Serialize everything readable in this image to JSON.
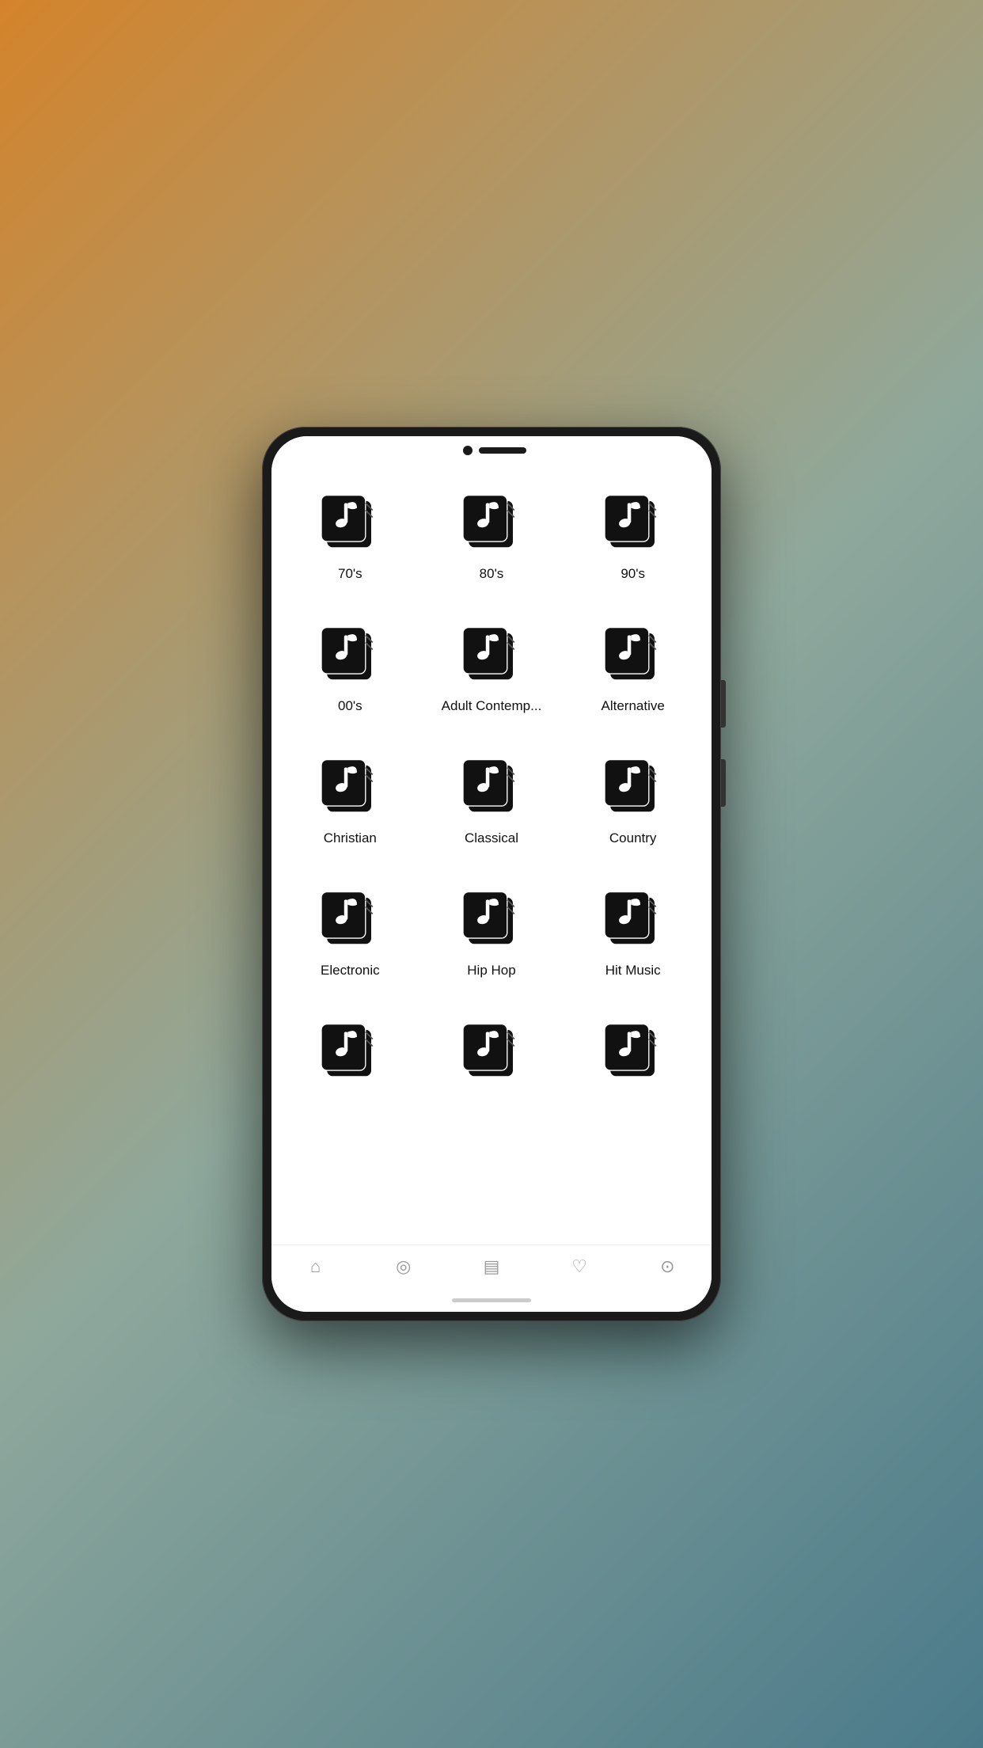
{
  "background": {
    "gradient_start": "#d4832a",
    "gradient_end": "#4a7a8a"
  },
  "genres": [
    {
      "id": "70s",
      "label": "70's"
    },
    {
      "id": "80s",
      "label": "80's"
    },
    {
      "id": "90s",
      "label": "90's"
    },
    {
      "id": "00s",
      "label": "00's"
    },
    {
      "id": "adult-contemp",
      "label": "Adult Contemp..."
    },
    {
      "id": "alternative",
      "label": "Alternative"
    },
    {
      "id": "christian",
      "label": "Christian"
    },
    {
      "id": "classical",
      "label": "Classical"
    },
    {
      "id": "country",
      "label": "Country"
    },
    {
      "id": "electronic",
      "label": "Electronic"
    },
    {
      "id": "hip-hop",
      "label": "Hip Hop"
    },
    {
      "id": "hit-music",
      "label": "Hit Music"
    },
    {
      "id": "partial1",
      "label": ""
    },
    {
      "id": "partial2",
      "label": ""
    },
    {
      "id": "partial3",
      "label": ""
    }
  ],
  "nav": {
    "home": "⌂",
    "search": "◎",
    "browse": "▤",
    "heart": "♡",
    "profile": "⊙"
  }
}
